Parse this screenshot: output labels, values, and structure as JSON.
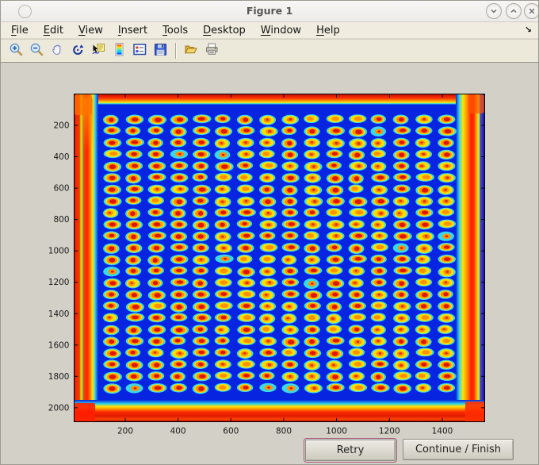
{
  "window": {
    "title": "Figure 1",
    "controls": [
      "minimize",
      "maximize",
      "close"
    ]
  },
  "menu": {
    "items": [
      "File",
      "Edit",
      "View",
      "Insert",
      "Tools",
      "Desktop",
      "Window",
      "Help"
    ],
    "overflow_icon": "dock-arrow"
  },
  "toolbar": {
    "items": [
      "zoom-in",
      "zoom-out",
      "pan",
      "rotate-3d",
      "data-cursor",
      "insert-colorbar",
      "insert-legend",
      "save-figure",
      "separator",
      "open-file",
      "print-figure"
    ]
  },
  "chart_data": {
    "type": "heatmap",
    "description": "Microarray slide scan rendered with jet colormap: 16 x 24 grid of spots (red cores, orange/yellow rings, cyan halos) on saturated blue background, with bright red/orange glow along all four slide edges",
    "x_ticks": [
      200,
      400,
      600,
      800,
      1000,
      1200,
      1400
    ],
    "y_ticks": [
      200,
      400,
      600,
      800,
      1000,
      1200,
      1400,
      1600,
      1800,
      2000
    ],
    "x_range": [
      0,
      1560
    ],
    "y_range": [
      0,
      2090
    ],
    "grid": {
      "cols": 16,
      "rows": 24
    },
    "colormap": "jet",
    "legend": "off",
    "colors": {
      "background": "#0724e0",
      "halo": "#38d9ec",
      "ring_yellow": "#ffdf00",
      "ring_orange": "#ff9100",
      "core_red": "#dd1700",
      "edge_red": "#ff2600",
      "edge_dark_red": "#c81400"
    }
  },
  "buttons": [
    {
      "label": "Retry",
      "highlighted": true
    },
    {
      "label": "Continue / Finish",
      "highlighted": false
    }
  ]
}
